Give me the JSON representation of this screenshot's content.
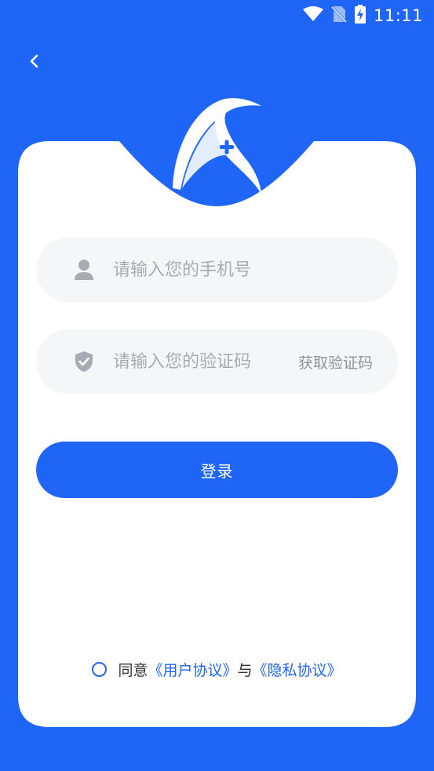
{
  "status_bar": {
    "time": "11:11",
    "icons": [
      "wifi-icon",
      "no-sim-icon",
      "battery-charging-icon"
    ]
  },
  "header": {
    "back_icon": "chevron-left-icon"
  },
  "logo": {
    "icon": "bird-plus-logo"
  },
  "form": {
    "phone_placeholder": "请输入您的手机号",
    "phone_icon": "user-icon",
    "code_placeholder": "请输入您的验证码",
    "code_icon": "shield-check-icon",
    "get_code_label": "获取验证码",
    "login_label": "登录"
  },
  "agreement": {
    "prefix": "同意",
    "user_agreement": "《用户协议》",
    "conjunction": "与",
    "privacy_agreement": "《隐私协议》"
  },
  "colors": {
    "primary": "#1f66f6",
    "input_bg": "#f5f6f8",
    "placeholder": "#a7abb3",
    "text": "#333333"
  }
}
